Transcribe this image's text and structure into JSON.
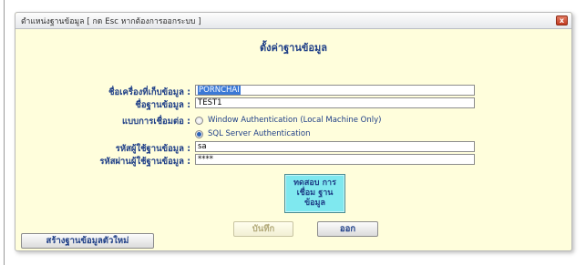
{
  "window": {
    "title": "ตำแหน่งฐานข้อมูล [ กด Esc หากต้องการออกระบบ ]",
    "close_glyph": "x"
  },
  "form": {
    "heading": "ตั้งค่าฐานข้อมูล",
    "server_label": "ชื่อเครื่องที่เก็บข้อมูล :",
    "server_value": "PORNCHAI",
    "database_label": "ชื่อฐานข้อมูล :",
    "database_value": "TEST1",
    "connection_label": "แบบการเชื่อมต่อ :",
    "auth_options": [
      {
        "label": "Window Authentication (Local Machine Only)",
        "selected": false
      },
      {
        "label": "SQL Server Authentication",
        "selected": true
      }
    ],
    "username_label": "รหัสผู้ใช้ฐานข้อมูล :",
    "username_value": "sa",
    "password_label": "รหัสผ่านผู้ใช้ฐานข้อมูล :",
    "password_value": "****"
  },
  "buttons": {
    "test_connection": "ทดสอบ การ เชื่อม ฐาน ข้อมูล",
    "save": "บันทึก",
    "exit": "ออก",
    "create_new_db": "สร้างฐานข้อมูลตัวใหม่"
  },
  "colors": {
    "window_bg": "#fffedc",
    "label_text": "#1f3f87",
    "test_button_bg": "#7fe8ef"
  }
}
